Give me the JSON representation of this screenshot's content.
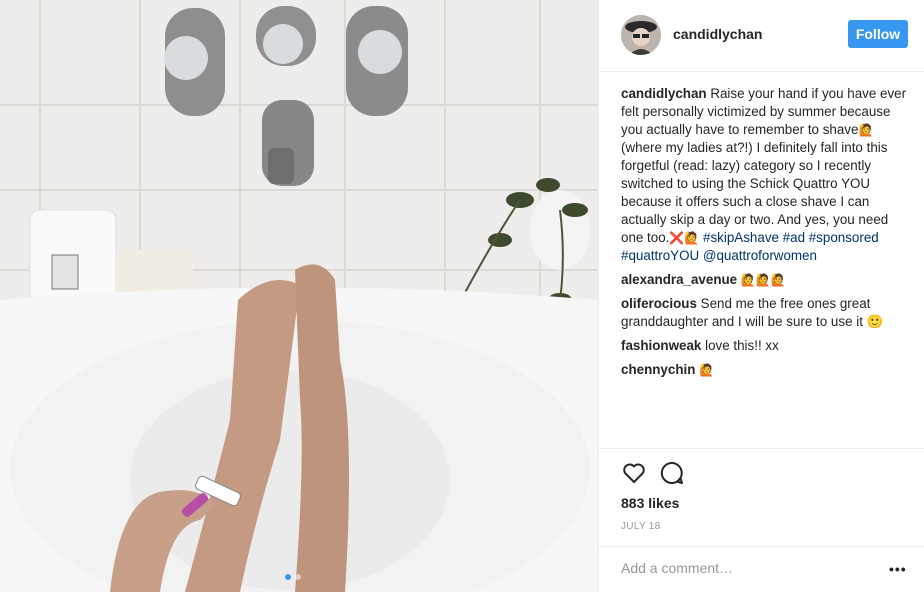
{
  "post": {
    "username": "candidlychan",
    "follow_label": "Follow"
  },
  "caption": {
    "username": "candidlychan",
    "text_1": "Raise your hand if you have ever felt personally victimized by summer because you actually have to remember to shave",
    "text_1_emoji": "🙋",
    "text_2": "(where my ladies at?!) I definitely fall into this forgetful (read: lazy) category so I recently switched to using the Schick Quattro YOU because it offers such a close shave I can actually skip a day or two. And yes, you need one too.",
    "text_2_emoji": "❌🙋",
    "hashtags": "#skipAshave #ad #sponsored #quattroYOU @quattroforwomen"
  },
  "comments": [
    {
      "username": "alexandra_avenue",
      "text": "🙋🙋🙋"
    },
    {
      "username": "oliferocious",
      "text": "Send me the free ones great granddaughter and I will be sure to use it 🙂"
    },
    {
      "username": "fashionweak",
      "text": "love this!! xx"
    },
    {
      "username": "chennychin",
      "text": "🙋"
    }
  ],
  "actions": {
    "like_icon": "heart-icon",
    "comment_icon": "comment-icon"
  },
  "likes": "883 likes",
  "date": "JULY 18",
  "add_comment": {
    "placeholder": "Add a comment…",
    "more_label": "•••"
  },
  "colors": {
    "accent": "#3897f0",
    "hashtag": "#003569",
    "muted": "#999999"
  }
}
